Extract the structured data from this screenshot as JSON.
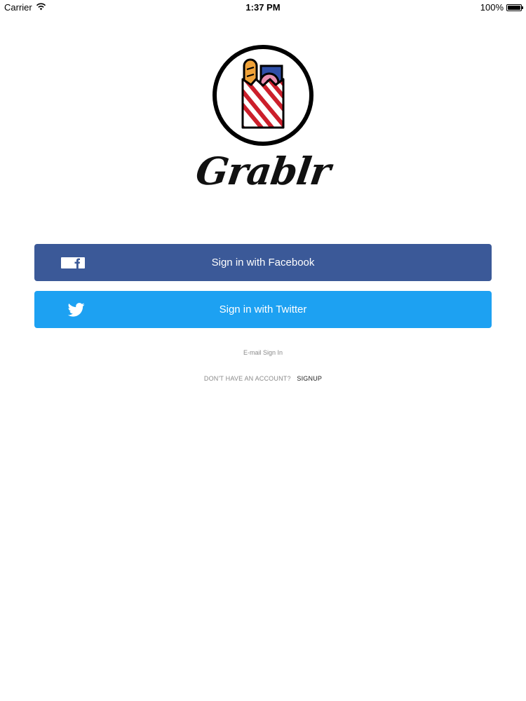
{
  "status_bar": {
    "carrier": "Carrier",
    "time": "1:37 PM",
    "battery_level": "100%"
  },
  "app": {
    "name": "Grablr"
  },
  "buttons": {
    "facebook_label": "Sign in with Facebook",
    "twitter_label": "Sign in with Twitter"
  },
  "links": {
    "email_signin": "E-mail Sign In",
    "signup_prompt": "DON'T HAVE AN ACCOUNT?",
    "signup": "SIGNUP"
  },
  "colors": {
    "facebook": "#3b5998",
    "twitter": "#1da1f2",
    "logo_stripe_red": "#cc1f2b",
    "logo_bread": "#f0a33a",
    "logo_box": "#2f4fa8"
  },
  "icons": {
    "wifi": "wifi-icon",
    "battery": "battery-icon",
    "facebook": "facebook-icon",
    "twitter": "twitter-bird-icon",
    "logo": "grocery-bag-icon"
  }
}
